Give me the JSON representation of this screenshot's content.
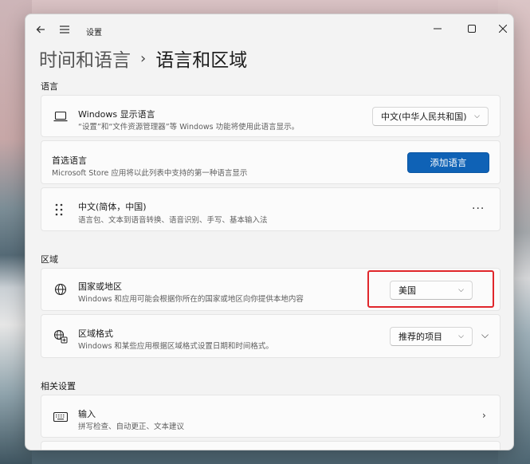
{
  "window": {
    "app_title": "设置"
  },
  "breadcrumb": {
    "parent": "时间和语言",
    "separator": "›",
    "current": "语言和区域"
  },
  "sections": {
    "language": "语言",
    "region": "区域",
    "related": "相关设置"
  },
  "language": {
    "display": {
      "title": "Windows 显示语言",
      "subtitle": "“设置”和“文件资源管理器”等 Windows 功能将使用此语言显示。",
      "selected": "中文(中华人民共和国)"
    },
    "preferred": {
      "title": "首选语言",
      "subtitle": "Microsoft Store 应用将以此列表中支持的第一种语言显示",
      "add_button": "添加语言"
    },
    "item": {
      "title": "中文(简体，中国)",
      "subtitle": "语言包、文本到语音转换、语音识别、手写、基本输入法",
      "more": "..."
    }
  },
  "region": {
    "country": {
      "title": "国家或地区",
      "subtitle": "Windows 和应用可能会根据你所在的国家或地区向你提供本地内容",
      "selected": "美国"
    },
    "format": {
      "title": "区域格式",
      "subtitle": "Windows 和某些应用根据区域格式设置日期和时间格式。",
      "selected": "推荐的项目"
    }
  },
  "related": {
    "input": {
      "title": "输入",
      "subtitle": "拼写检查、自动更正、文本建议"
    }
  },
  "colors": {
    "accent": "#0f62b6",
    "highlight": "#e0262b"
  }
}
